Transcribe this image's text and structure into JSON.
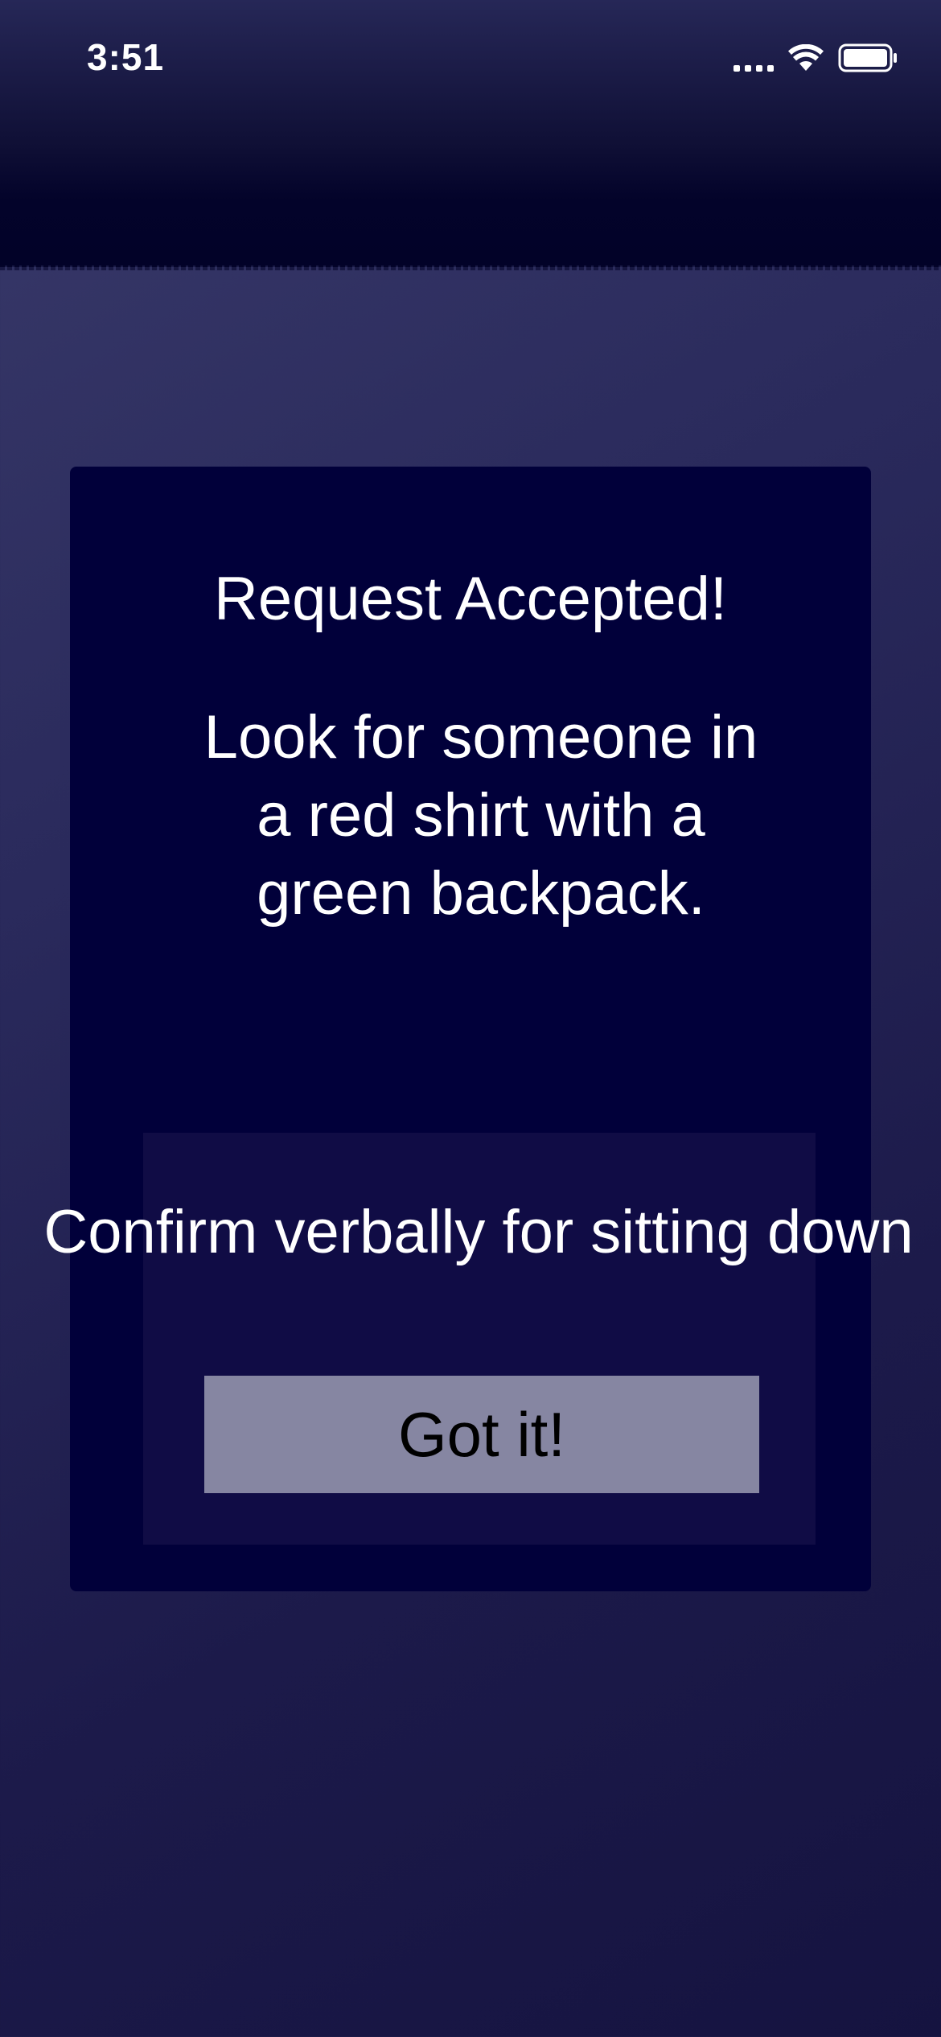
{
  "status_bar": {
    "time": "3:51",
    "icons": [
      "cellular-signal-icon",
      "wifi-icon",
      "battery-icon"
    ]
  },
  "card": {
    "title": "Request Accepted!",
    "message": "Look for someone in a red shirt with a green backpack."
  },
  "confirm_panel": {
    "text": "Confirm verbally for sitting down",
    "button_label": "Got it!"
  },
  "colors": {
    "card_background": "#01003a",
    "panel_background": "#100c45",
    "button_background": "#8686a2",
    "text": "#ffffff",
    "button_text": "#000000"
  }
}
